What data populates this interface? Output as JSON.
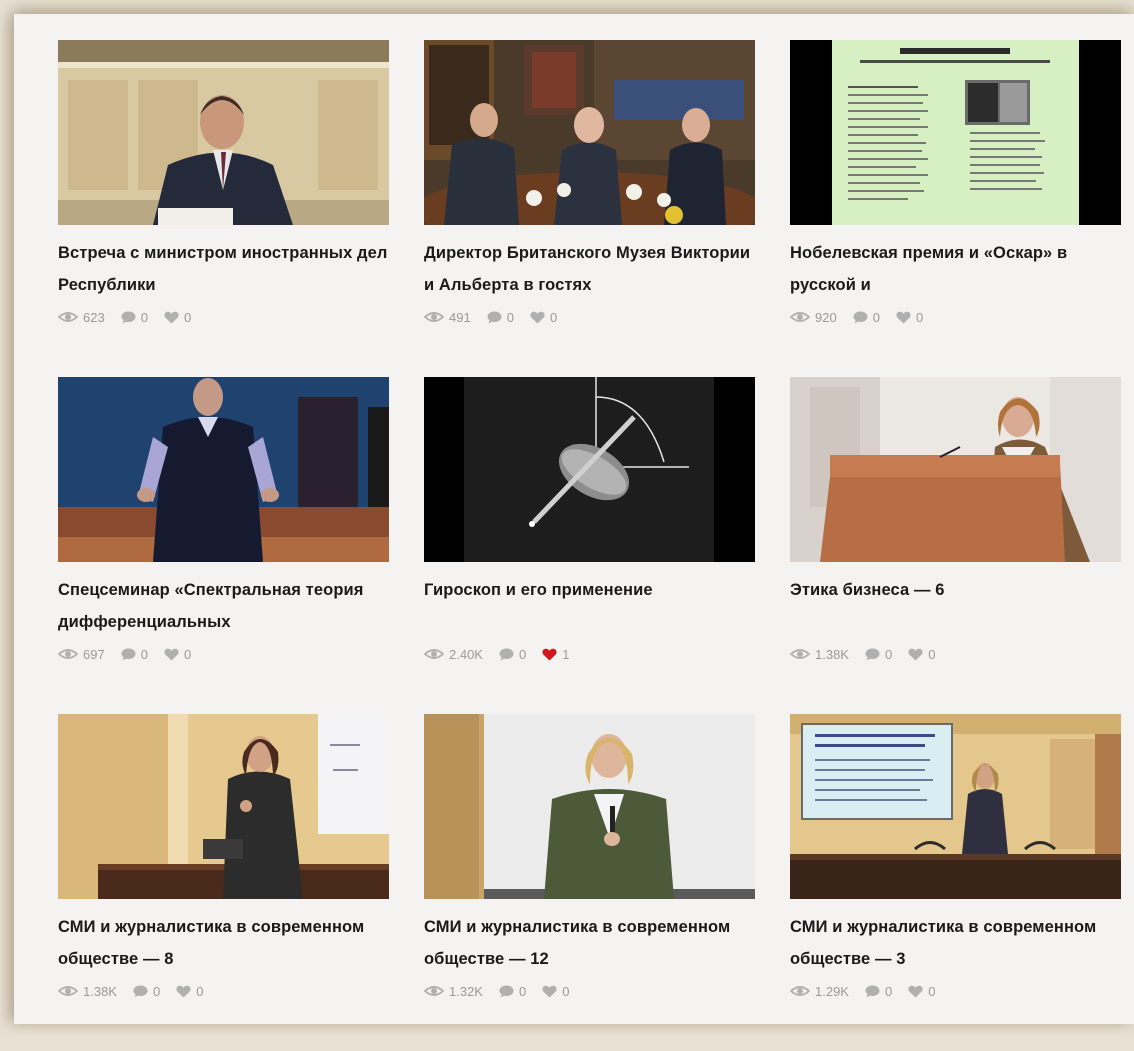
{
  "colors": {
    "icon_gray": "#b0b0b0",
    "like_red": "#d0171d",
    "title_text": "#1a1a1a",
    "meta_text": "#9a9a9a"
  },
  "icons": {
    "views": "eye-icon",
    "comments": "comment-bubble-icon",
    "likes": "heart-icon"
  },
  "videos": [
    {
      "title": "Встреча с министром иностранных дел Республики",
      "views": "623",
      "comments": "0",
      "likes": "0",
      "liked": false
    },
    {
      "title": "Директор Британского Музея Виктории и Альберта в гостях",
      "views": "491",
      "comments": "0",
      "likes": "0",
      "liked": false
    },
    {
      "title": "Нобелевская премия и «Оскар» в русской и",
      "views": "920",
      "comments": "0",
      "likes": "0",
      "liked": false
    },
    {
      "title": "Спецсеминар «Спектральная теория дифференциальных",
      "views": "697",
      "comments": "0",
      "likes": "0",
      "liked": false
    },
    {
      "title": "Гироскоп и его применение",
      "views": "2.40K",
      "comments": "0",
      "likes": "1",
      "liked": true
    },
    {
      "title": "Этика бизнеса — 6",
      "views": "1.38K",
      "comments": "0",
      "likes": "0",
      "liked": false
    },
    {
      "title": "СМИ и журналистика в современном обществе — 8",
      "views": "1.38K",
      "comments": "0",
      "likes": "0",
      "liked": false
    },
    {
      "title": "СМИ и журналистика в современном обществе — 12",
      "views": "1.32K",
      "comments": "0",
      "likes": "0",
      "liked": false
    },
    {
      "title": "СМИ и журналистика в современном обществе — 3",
      "views": "1.29K",
      "comments": "0",
      "likes": "0",
      "liked": false
    }
  ]
}
